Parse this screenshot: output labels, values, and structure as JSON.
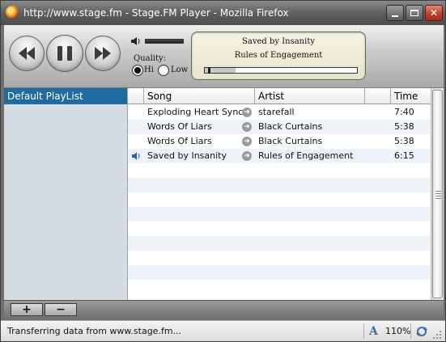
{
  "window": {
    "title": "http://www.stage.fm - Stage.FM Player - Mozilla Firefox",
    "min_glyph": "_",
    "close_glyph": "✕"
  },
  "player": {
    "quality_label": "Quality:",
    "quality_options": [
      "Hi",
      "Low"
    ],
    "quality_selected": "Hi",
    "volume_level": 1.0,
    "now_playing": {
      "song": "Saved by Insanity",
      "album": "Rules of Engagement"
    },
    "progress_fraction": 0.02,
    "buffer_fraction": 0.2
  },
  "sidebar": {
    "items": [
      {
        "label": "Default PlayList",
        "selected": true
      }
    ]
  },
  "table": {
    "columns": {
      "song": "Song",
      "artist": "Artist",
      "time": "Time"
    },
    "rows": [
      {
        "song": "Exploding Heart Sync",
        "artist": "starefall",
        "time": "7:40",
        "playing": false
      },
      {
        "song": "Words Of Liars",
        "artist": "Black Curtains",
        "time": "5:38",
        "playing": false
      },
      {
        "song": "Words Of Liars",
        "artist": "Black Curtains",
        "time": "5:38",
        "playing": false
      },
      {
        "song": "Saved by Insanity",
        "artist": "Rules of Engagement",
        "time": "6:15",
        "playing": true
      }
    ]
  },
  "toolbar": {
    "add_label": "+",
    "remove_label": "−"
  },
  "statusbar": {
    "text": "Transferring data from www.stage.fm...",
    "zoom": "110%",
    "zoom_icon_glyph": "A"
  },
  "colors": {
    "selection": "#1f6aa0",
    "sidebar_bg": "#d5dce4",
    "row_alt": "#eef3f9"
  }
}
